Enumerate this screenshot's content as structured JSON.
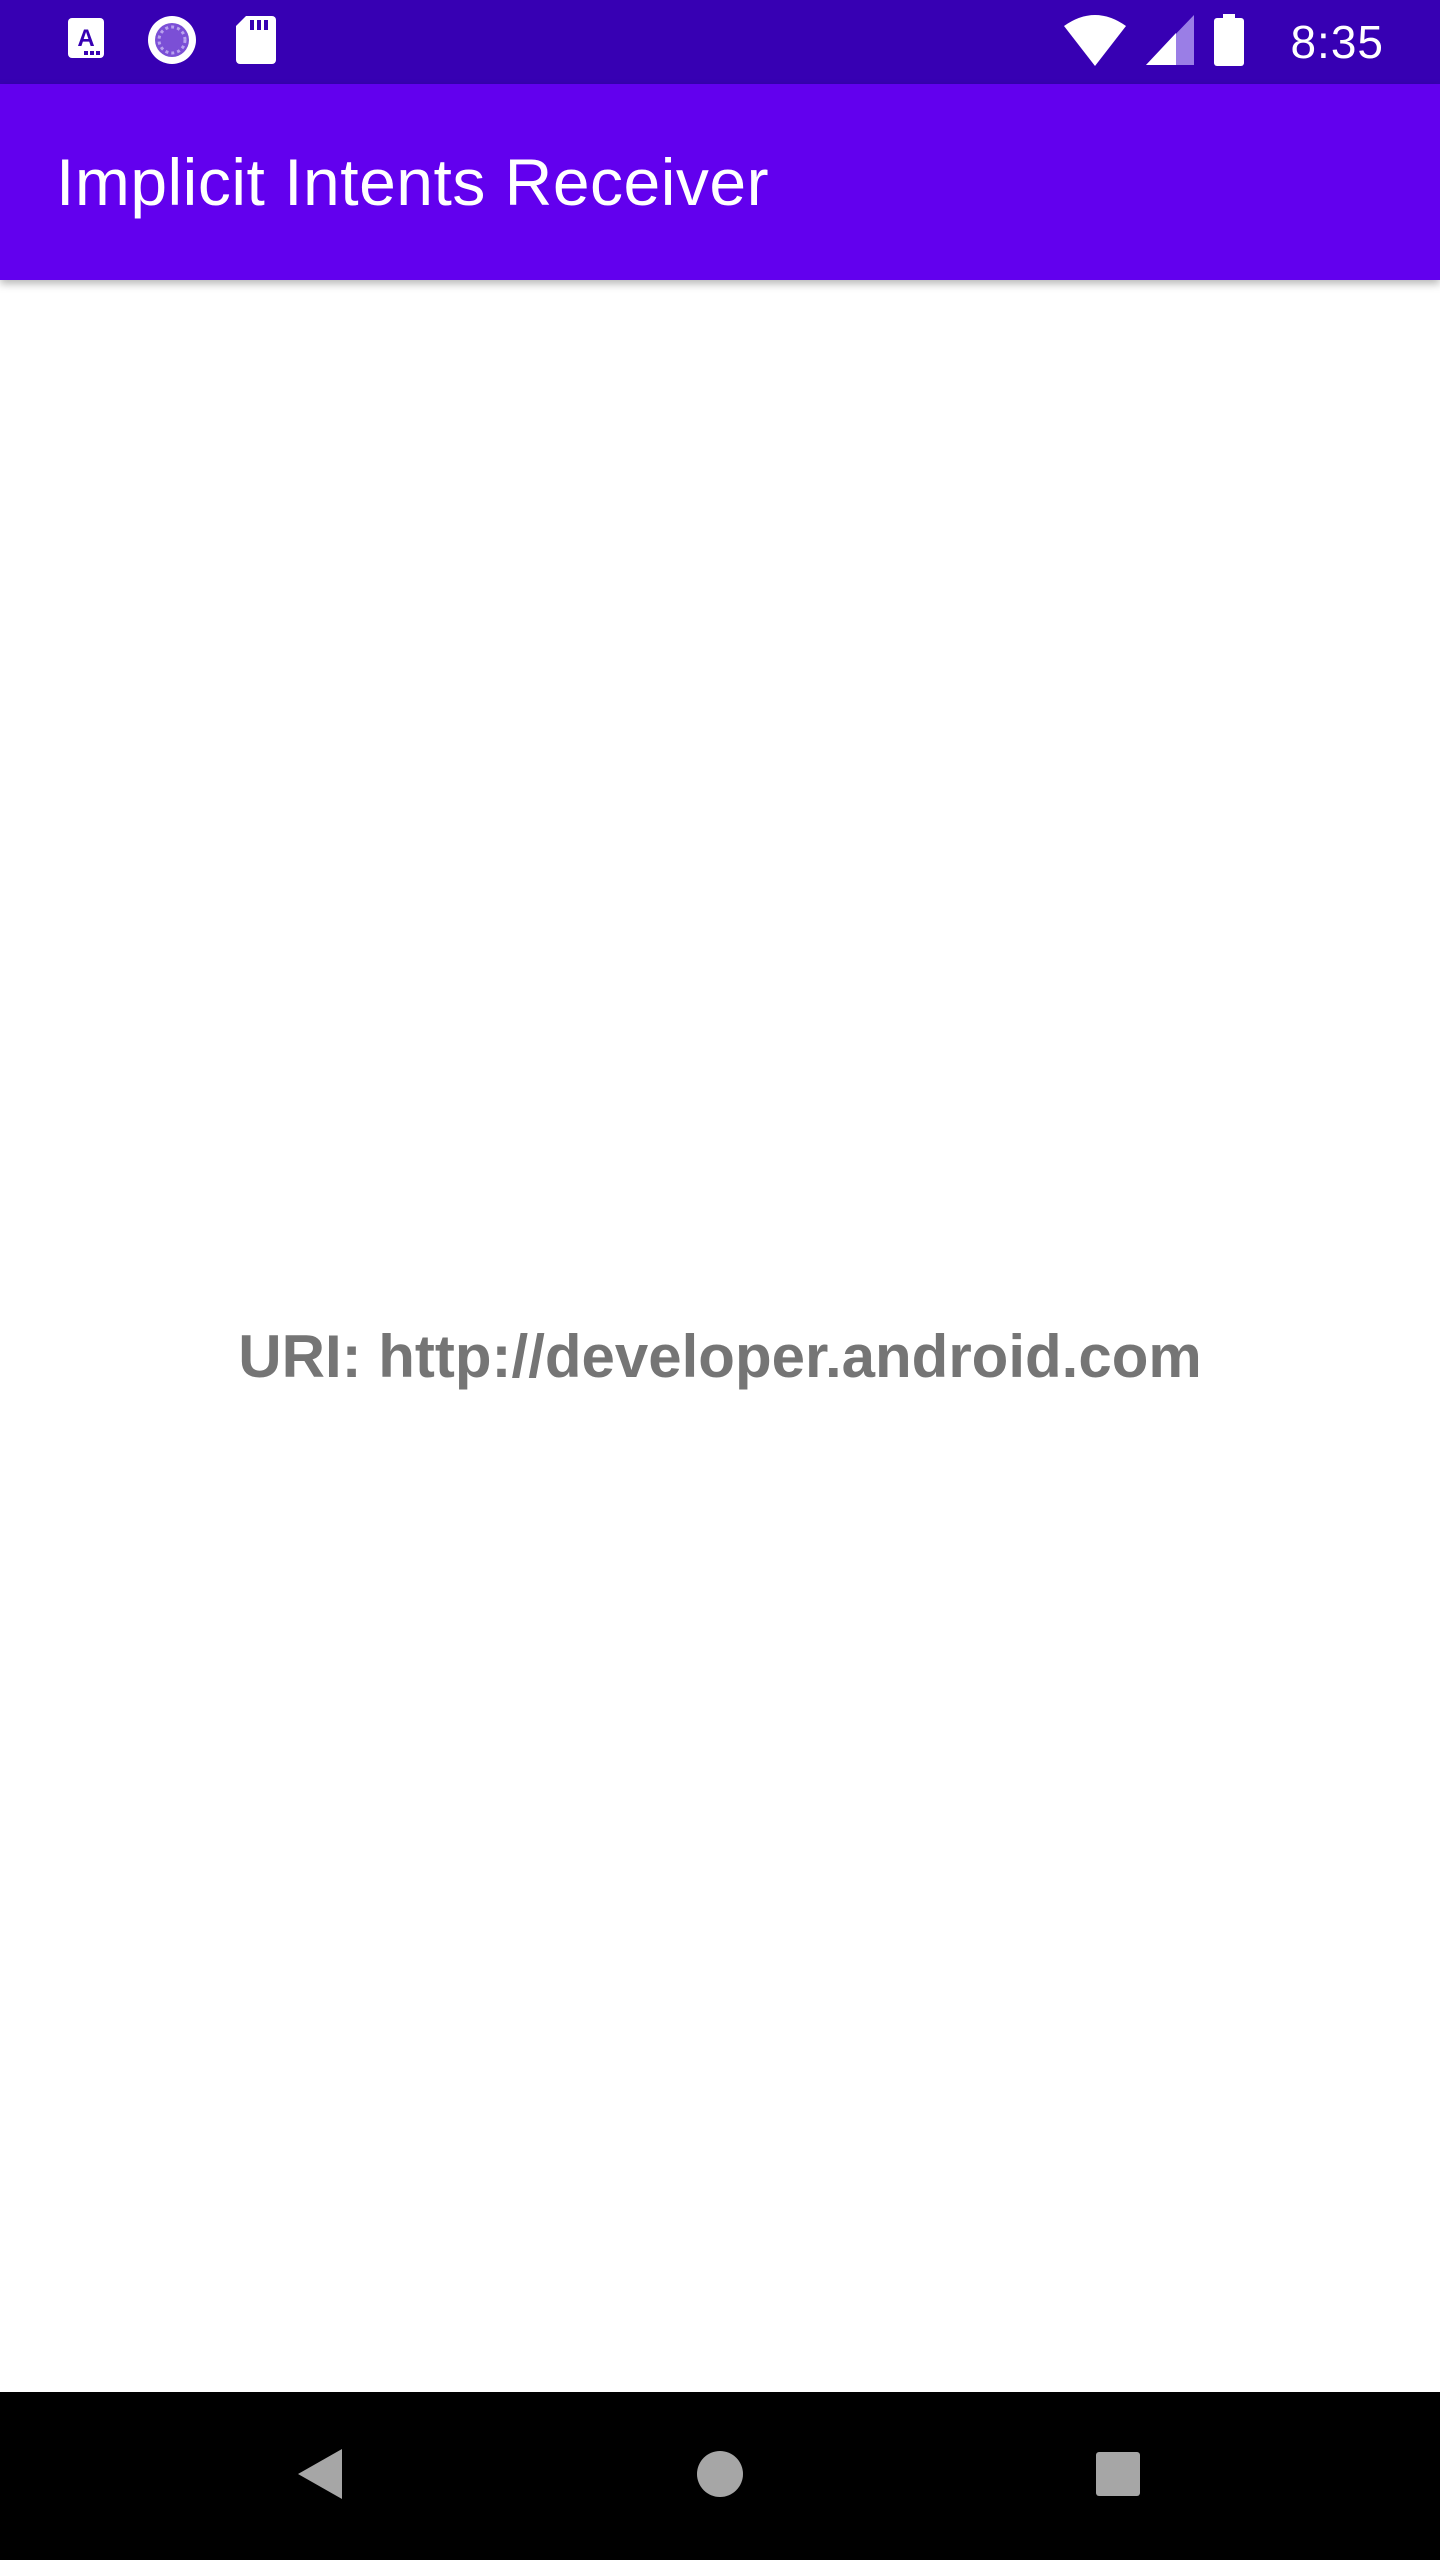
{
  "status_bar": {
    "time": "8:35",
    "left_icons": [
      "translate-app-icon",
      "loading-spinner-icon",
      "sd-card-icon"
    ],
    "right_icons": [
      "wifi-icon",
      "cellular-signal-icon",
      "battery-icon"
    ],
    "background_color": "#3700b3"
  },
  "app_bar": {
    "title": "Implicit Intents Receiver",
    "background_color": "#6200ee"
  },
  "main": {
    "uri_text": "URI: http://developer.android.com"
  },
  "nav_bar": {
    "buttons": [
      "back-icon",
      "home-icon",
      "recents-icon"
    ]
  }
}
